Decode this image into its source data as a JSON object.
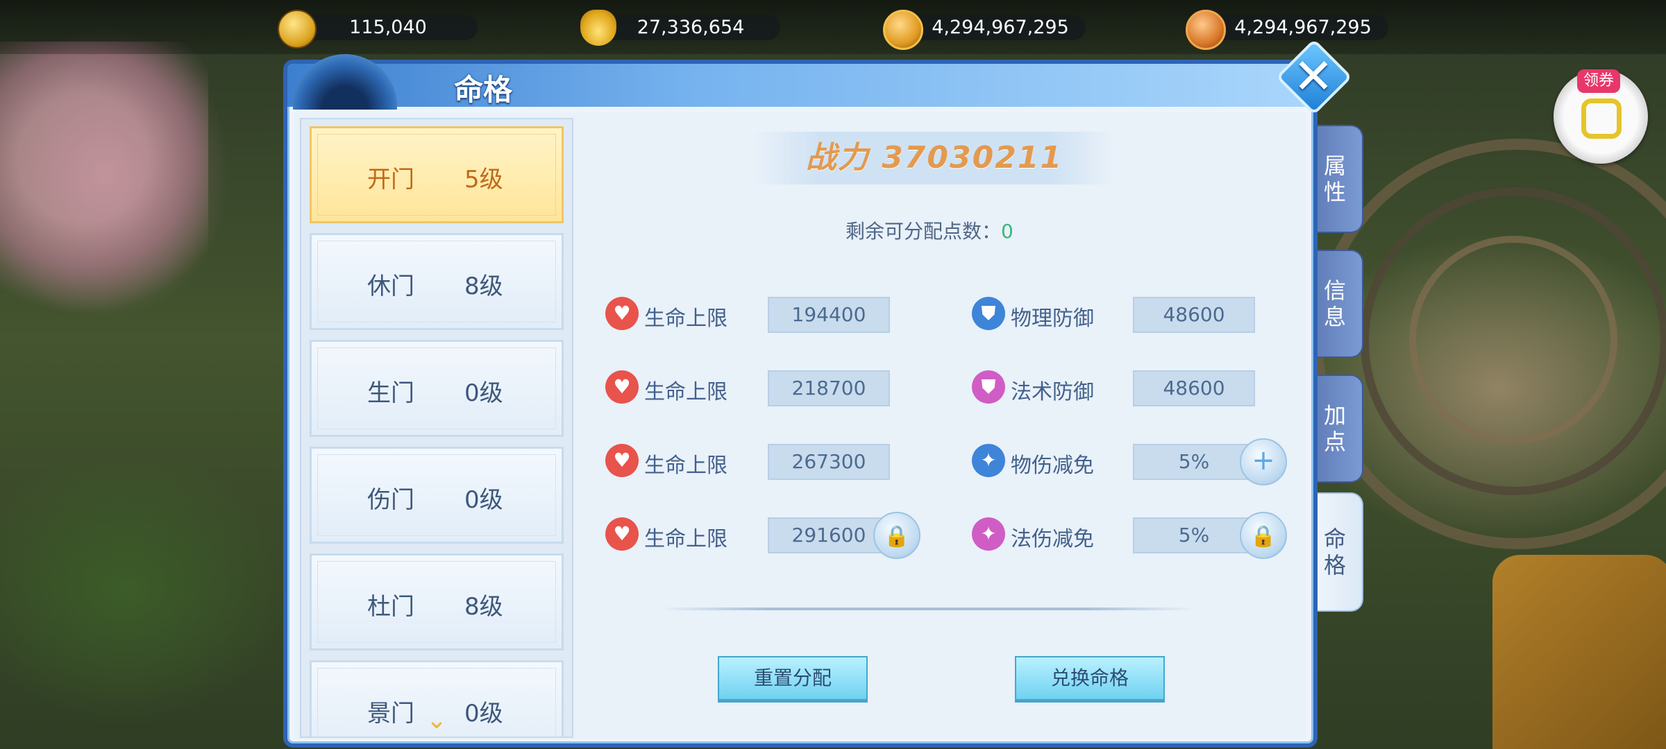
{
  "currencies": [
    {
      "icon": "coin-icon",
      "value": "115,040"
    },
    {
      "icon": "gold-ingot-icon",
      "value": "27,336,654"
    },
    {
      "icon": "merit-medal-icon",
      "value": "4,294,967,295"
    },
    {
      "icon": "honor-badge-icon",
      "value": "4,294,967,295"
    }
  ],
  "coupon": {
    "label": "领券"
  },
  "panel": {
    "title": "命格"
  },
  "gates": [
    {
      "name": "开门",
      "level": "5级"
    },
    {
      "name": "休门",
      "level": "8级"
    },
    {
      "name": "生门",
      "level": "0级"
    },
    {
      "name": "伤门",
      "level": "0级"
    },
    {
      "name": "杜门",
      "level": "8级"
    },
    {
      "name": "景门",
      "level": "0级"
    }
  ],
  "power": "战力 37030211",
  "remaining": {
    "label": "剩余可分配点数：",
    "value": "0"
  },
  "stats_left": [
    {
      "icon": "heart-icon",
      "label": "生命上限",
      "value": "194400"
    },
    {
      "icon": "heart-icon",
      "label": "生命上限",
      "value": "218700"
    },
    {
      "icon": "heart-icon",
      "label": "生命上限",
      "value": "267300"
    },
    {
      "icon": "heart-icon",
      "label": "生命上限",
      "value": "291600"
    }
  ],
  "stats_right": [
    {
      "icon": "physical-defense-icon",
      "label": "物理防御",
      "value": "48600"
    },
    {
      "icon": "magic-defense-icon",
      "label": "法术防御",
      "value": "48600"
    },
    {
      "icon": "physical-reduction-icon",
      "label": "物伤减免",
      "value": "5%"
    },
    {
      "icon": "magic-reduction-icon",
      "label": "法伤减免",
      "value": "5%"
    }
  ],
  "buttons": {
    "reset": "重置分配",
    "exchange": "兑换命格"
  },
  "tabs": [
    {
      "label": "属\n性",
      "active": false
    },
    {
      "label": "信\n息",
      "active": false
    },
    {
      "label": "加\n点",
      "active": false
    },
    {
      "label": "命\n格",
      "active": true
    }
  ],
  "colors": {
    "accent": "#2f63b4",
    "active_gate": "#ffe59a",
    "power_text": "#e39a4f",
    "remain_value": "#39b77b"
  }
}
